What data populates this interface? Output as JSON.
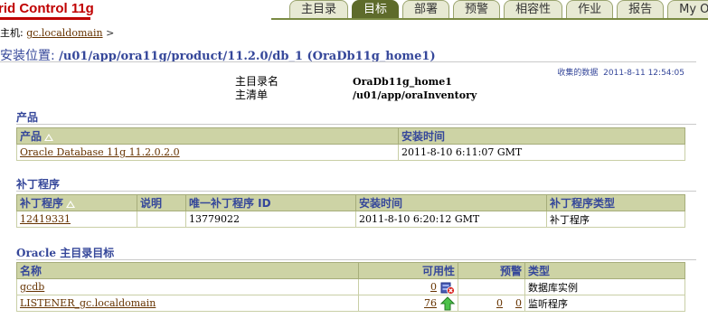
{
  "header": {
    "brand": "rid Control 11g",
    "tabs": [
      "主目录",
      "目标",
      "部署",
      "预警",
      "相容性",
      "作业",
      "报告",
      "My Orac"
    ],
    "active_tab": "目标"
  },
  "breadcrumb": {
    "host_label": "主机:",
    "host_link": "gc.localdomain",
    "separator": ">"
  },
  "page": {
    "title_label": "安装位置: ",
    "title_value": "/u01/app/ora11g/product/11.2.0/db_1 (OraDb11g_home1)",
    "collected_label": "收集的数据",
    "collected_time": "2011-8-11 12:54:05"
  },
  "info": {
    "home_name_label": "主目录名",
    "home_name_value": "OraDb11g_home1",
    "inventory_label": "主清单",
    "inventory_value": "/u01/app/oraInventory"
  },
  "products": {
    "title": "产品",
    "columns": [
      "产品",
      "安装时间"
    ],
    "rows": [
      {
        "product": "Oracle Database 11g 11.2.0.2.0",
        "install_time": "2011-8-10 6:11:07 GMT"
      }
    ]
  },
  "patches": {
    "title": "补丁程序",
    "columns": [
      "补丁程序",
      "说明",
      "唯一补丁程序 ID",
      "安装时间",
      "补丁程序类型"
    ],
    "rows": [
      {
        "patch": "12419331",
        "description": "",
        "unique_id": "13779022",
        "install_time": "2011-8-10 6:20:12 GMT",
        "type": "补丁程序"
      }
    ]
  },
  "targets": {
    "title_prefix": "Oracle",
    "title_suffix": " 主目录目标",
    "columns": [
      "名称",
      "可用性",
      "预警",
      "类型"
    ],
    "rows": [
      {
        "name": "gcdb",
        "availability": "0",
        "availability_icon": "database-down-icon",
        "alert_a": "",
        "alert_b": "",
        "type": "数据库实例"
      },
      {
        "name": "LISTENER_gc.localdomain",
        "availability": "76",
        "availability_icon": "up-arrow-icon",
        "alert_a": "0",
        "alert_b": "0",
        "type": "监听程序"
      }
    ]
  },
  "colors": {
    "link": "#663300",
    "heading": "#35479a",
    "table_header": "#cdd3a5",
    "tab_active": "#5e6b2b"
  }
}
